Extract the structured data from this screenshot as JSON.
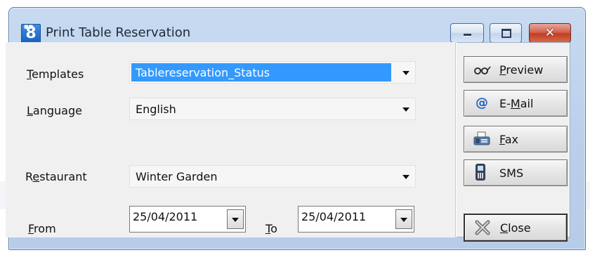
{
  "window": {
    "title": "Print Table Reservation",
    "icon_label": "8",
    "icon_name": "app-8-icon"
  },
  "form": {
    "templates": {
      "label_underlined": "T",
      "label_rest": "emplates",
      "value": "Tablereservation_Status"
    },
    "language": {
      "label_underlined": "L",
      "label_rest": "anguage",
      "value": "English"
    },
    "restaurant": {
      "label_pre": "R",
      "label_underlined": "e",
      "label_rest": "staurant",
      "value": "Winter Garden"
    },
    "from": {
      "label_underlined": "F",
      "label_rest": "rom",
      "value": "25/04/2011"
    },
    "to": {
      "label_underlined": "T",
      "label_rest": "o",
      "value": "25/04/2011"
    }
  },
  "actions": {
    "preview": {
      "pre": "",
      "underlined": "P",
      "rest": "review",
      "icon": "glasses-icon"
    },
    "email": {
      "pre": "E-",
      "underlined": "M",
      "rest": "ail",
      "icon": "at-sign-icon"
    },
    "fax": {
      "pre": "",
      "underlined": "F",
      "rest": "ax",
      "icon": "fax-icon"
    },
    "sms": {
      "pre": "",
      "underlined": "",
      "rest": "SMS",
      "icon": "mobile-phone-icon"
    },
    "close": {
      "pre": "",
      "underlined": "C",
      "rest": "lose",
      "icon": "close-x-icon"
    }
  },
  "colors": {
    "selection": "#3399ff",
    "title_bar": "#c7daf1",
    "close_button": "#c13f26"
  }
}
